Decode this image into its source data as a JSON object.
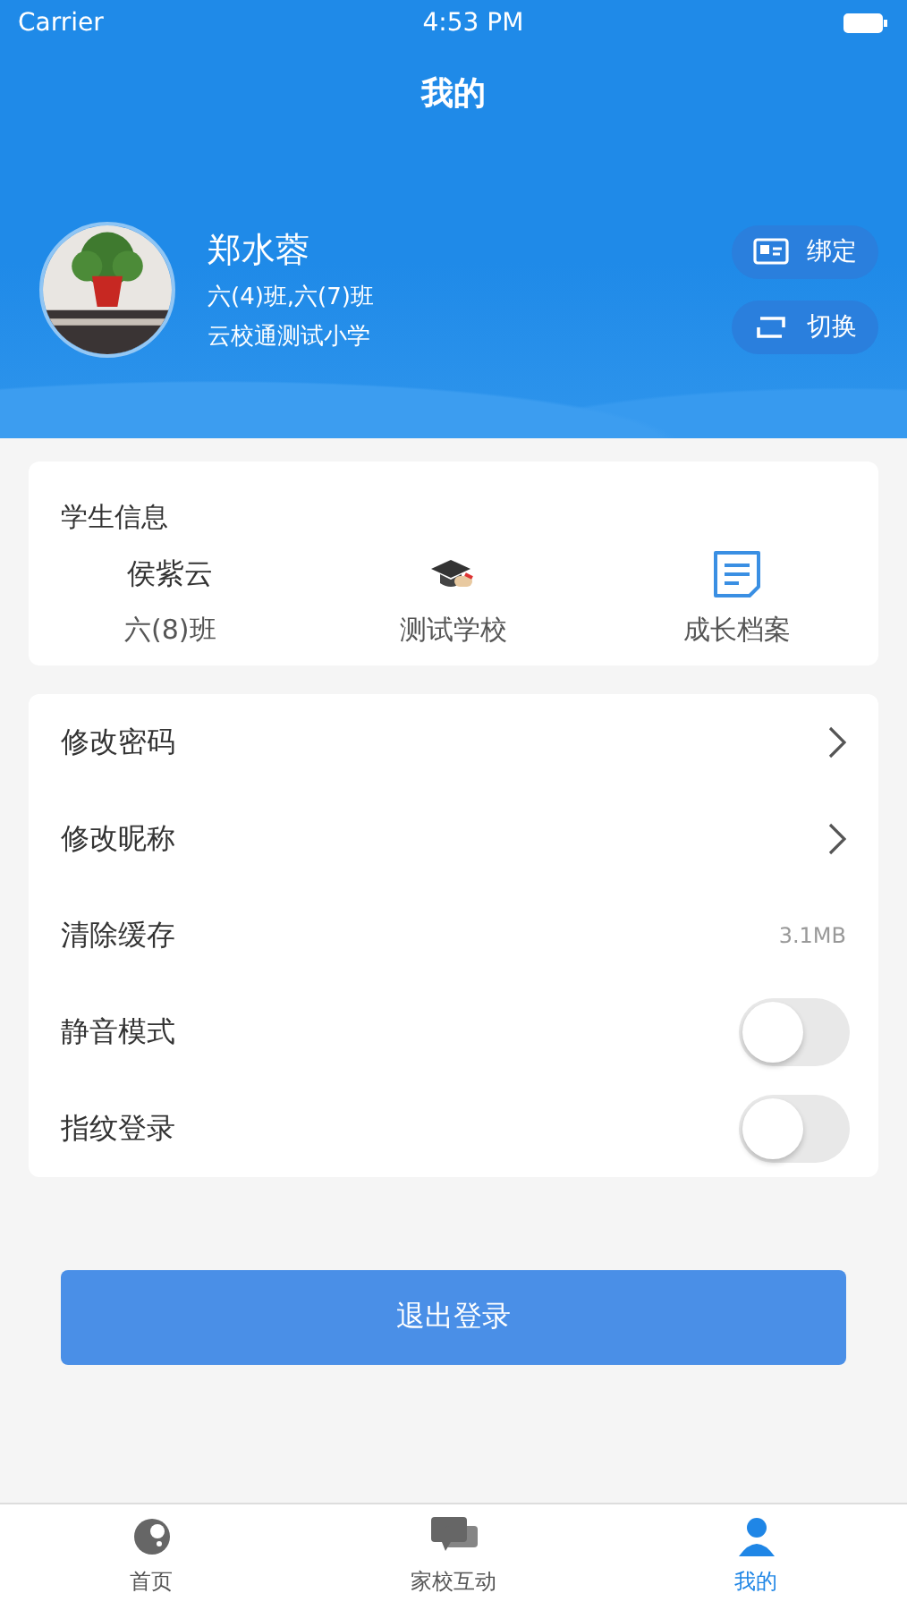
{
  "status_bar": {
    "carrier": "Carrier",
    "time": "4:53 PM"
  },
  "nav": {
    "title": "我的"
  },
  "profile": {
    "name": "郑水蓉",
    "classes": "六(4)班,六(7)班",
    "school": "云校通测试小学",
    "actions": [
      {
        "kind": "bind",
        "label": "绑定"
      },
      {
        "kind": "switch",
        "label": "切换"
      }
    ]
  },
  "student_info": {
    "title": "学生信息",
    "items": [
      {
        "kind": "name",
        "top": "侯紫云",
        "bottom": "六(8)班"
      },
      {
        "kind": "school",
        "bottom": "测试学校"
      },
      {
        "kind": "archive",
        "bottom": "成长档案"
      }
    ]
  },
  "settings": [
    {
      "kind": "arrow",
      "label": "修改密码"
    },
    {
      "kind": "arrow",
      "label": "修改昵称"
    },
    {
      "kind": "value",
      "label": "清除缓存",
      "value": "3.1MB"
    },
    {
      "kind": "switch",
      "label": "静音模式",
      "on": false
    },
    {
      "kind": "switch",
      "label": "指纹登录",
      "on": false
    }
  ],
  "logout_button": "退出登录",
  "tab_bar": [
    {
      "kind": "home",
      "label": "首页",
      "selected": false
    },
    {
      "kind": "chat",
      "label": "家校互动",
      "selected": false
    },
    {
      "kind": "me",
      "label": "我的",
      "selected": true
    }
  ]
}
